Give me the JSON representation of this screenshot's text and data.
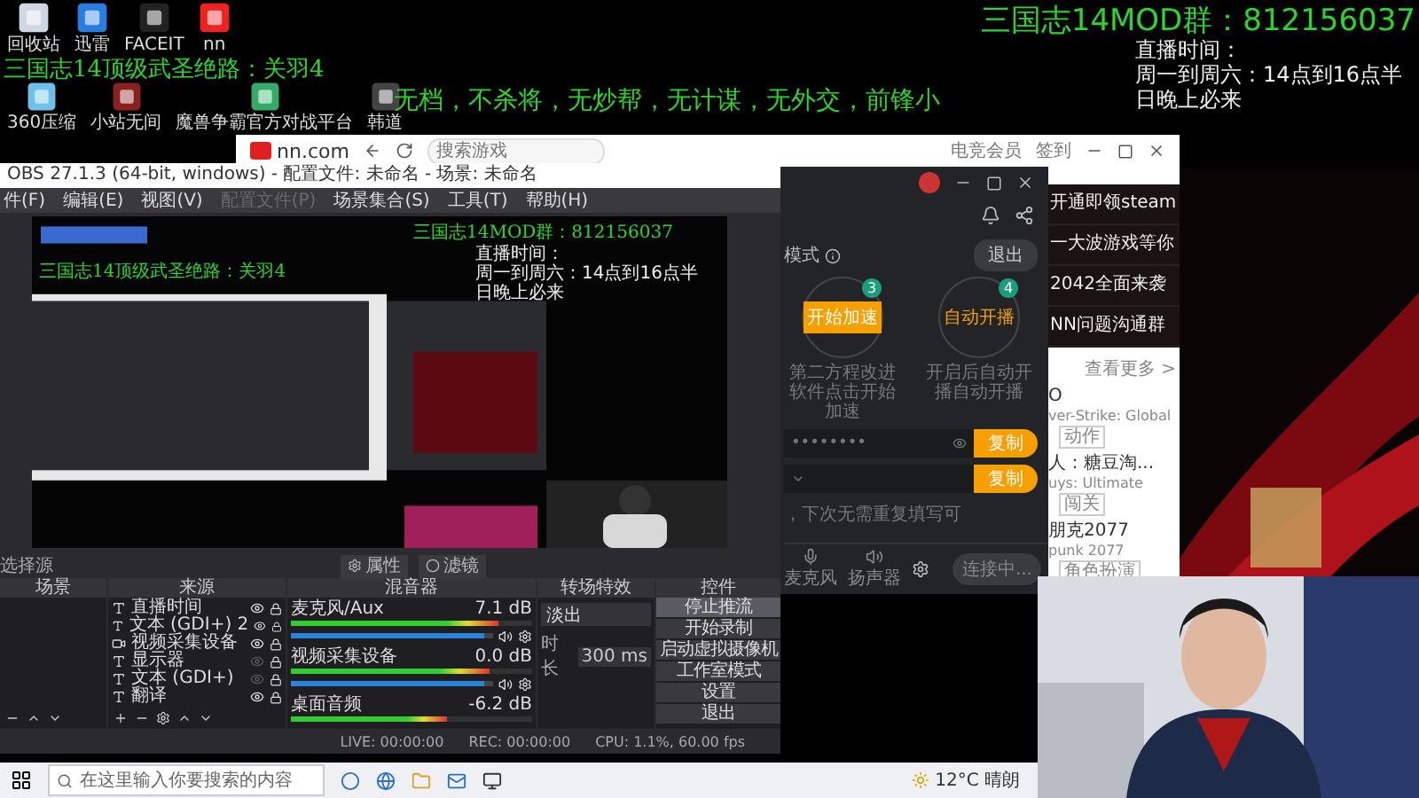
{
  "desktop_icons": [
    {
      "label": "回收站"
    },
    {
      "label": "迅雷"
    },
    {
      "label": "FACEIT"
    },
    {
      "label": "nn"
    },
    {
      "label": "360压缩"
    },
    {
      "label": "小站无间"
    },
    {
      "label": "魔兽争霸官方对战平台"
    },
    {
      "label": "韩道"
    }
  ],
  "overlay": {
    "route_lines": [
      "三国志14顶级武圣绝路：关羽4",
      "无档，不杀将，无炒帮，无计谋，无外交，前锋小"
    ],
    "group": "三国志14MOD群：812156037",
    "schedule": [
      "直播时间：",
      "周一到周六：14点到16点半",
      "日晚上必来"
    ]
  },
  "browser": {
    "site": "nn.com",
    "search_placeholder": "搜索游戏",
    "toolbar": [
      "电竞会员",
      "签到"
    ],
    "banner_items": [
      "开通即领steam",
      "一大波游戏等你",
      "2042全面来袭",
      "NN问题沟通群"
    ],
    "more": "查看更多 >",
    "games": [
      {
        "title": "O",
        "subtitle": "ver-Strike: Global",
        "tag": "动作"
      },
      {
        "title": "人：糖豆淘...",
        "subtitle": "uys: Ultimate",
        "tag": "闯关"
      },
      {
        "title": "朋克2077",
        "subtitle": "punk 2077",
        "tag": "角色扮演"
      }
    ]
  },
  "accelerator": {
    "mode_label": "模式",
    "exit": "退出",
    "steps": [
      {
        "badge": "3",
        "kind": "button",
        "label": "开始加速",
        "desc": "第二方程改进软件点击开始加速"
      },
      {
        "badge": "4",
        "kind": "text",
        "label": "自动开播",
        "desc": "开启后自动开播自动开播"
      }
    ],
    "fields": [
      {
        "value": "••••••••",
        "action": "复制"
      },
      {
        "action": "复制"
      }
    ],
    "note": "，下次无需重复填写可",
    "devices": [
      "麦克风",
      "扬声器"
    ],
    "connect": "连接中..."
  },
  "obs": {
    "title": "OBS 27.1.3 (64-bit, windows) - 配置文件: 未命名 - 场景: 未命名",
    "menu": [
      {
        "label": "件(F)",
        "disabled": false
      },
      {
        "label": "编辑(E)",
        "disabled": false
      },
      {
        "label": "视图(V)",
        "disabled": false
      },
      {
        "label": "配置文件(P)",
        "disabled": true
      },
      {
        "label": "场景集合(S)",
        "disabled": false
      },
      {
        "label": "工具(T)",
        "disabled": false
      },
      {
        "label": "帮助(H)",
        "disabled": false
      }
    ],
    "preview": {
      "route": "三国志14顶级武圣绝路：关羽4",
      "group": "三国志14MOD群：812156037",
      "schedule": [
        "直播时间：",
        "周一到周六：14点到16点半",
        "日晚上必来"
      ]
    },
    "source_toolbar": {
      "selection": "选择源",
      "buttons": [
        "属性",
        "滤镜"
      ]
    },
    "docks": [
      "场景",
      "来源",
      "混音器",
      "转场特效",
      "控件"
    ],
    "sources": [
      {
        "name": "直播时间",
        "visible": true
      },
      {
        "name": "文本 (GDI+) 2",
        "visible": true
      },
      {
        "name": "视频采集设备",
        "visible": true
      },
      {
        "name": "显示器",
        "visible": false
      },
      {
        "name": "文本 (GDI+)",
        "visible": false
      },
      {
        "name": "翻译",
        "visible": true
      }
    ],
    "mixer": [
      {
        "name": "麦克风/Aux",
        "reading": "7.1 dB",
        "meter": {
          "level": 0.86
        },
        "fader": {
          "level": 0.96
        }
      },
      {
        "name": "视频采集设备",
        "reading": "0.0 dB",
        "meter": {
          "level": 0.82
        },
        "fader": {
          "level": 0.96
        }
      },
      {
        "name": "桌面音频",
        "reading": "-6.2 dB",
        "meter": {
          "level": 0.65
        }
      }
    ],
    "transition": {
      "value": "淡出",
      "duration_label": "时长",
      "duration": "300 ms"
    },
    "controls": [
      {
        "label": "停止推流",
        "selected": true
      },
      {
        "label": "开始录制",
        "selected": false
      },
      {
        "label": "启动虚拟摄像机",
        "selected": false
      },
      {
        "label": "工作室模式",
        "selected": false
      },
      {
        "label": "设置",
        "selected": false
      },
      {
        "label": "退出",
        "selected": false
      }
    ],
    "status": [
      "LIVE: 00:00:00",
      "REC: 00:00:00",
      "CPU: 1.1%, 60.00 fps"
    ]
  },
  "taskbar": {
    "search_placeholder": "在这里输入你要搜索的内容",
    "weather": "12°C 晴朗"
  }
}
